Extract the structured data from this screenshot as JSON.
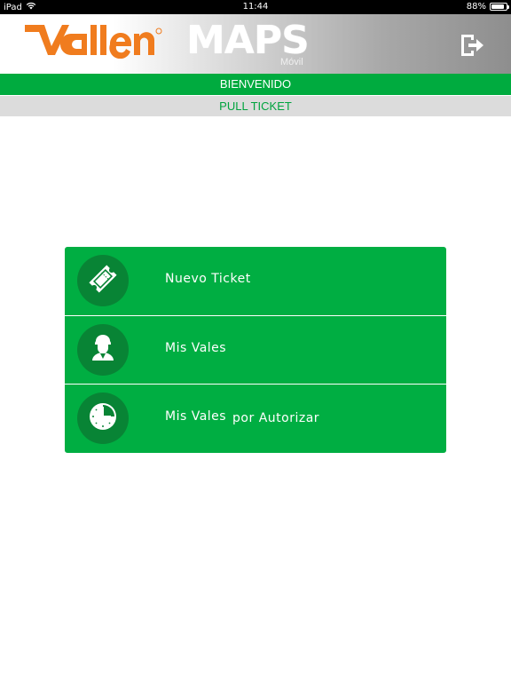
{
  "status_bar": {
    "device": "iPad",
    "time": "11:44",
    "battery_percent": "88%",
    "battery_level": 0.88
  },
  "header": {
    "logo_text": "Vallen",
    "app_title": "MAPS",
    "app_subtitle": "Móvil",
    "logout_icon": "logout-icon"
  },
  "welcome_bar": {
    "text": "BIENVENIDO"
  },
  "section_bar": {
    "text": "PULL TICKET"
  },
  "menu": {
    "items": [
      {
        "label": "Nuevo Ticket",
        "suffix": "",
        "icon": "ticket-icon"
      },
      {
        "label": "Mis Vales",
        "suffix": "",
        "icon": "worker-icon"
      },
      {
        "label": "Mis Vales",
        "suffix": "por Autorizar",
        "icon": "clock-icon"
      }
    ]
  },
  "colors": {
    "brand_green": "#00ae42",
    "dark_green": "#088435",
    "vallen_orange": "#f07c1e",
    "section_text_green": "#00a33e"
  }
}
